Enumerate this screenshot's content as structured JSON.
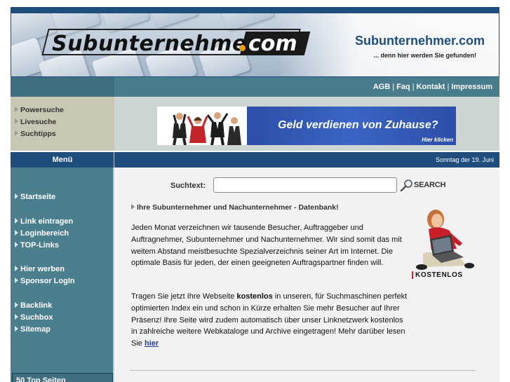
{
  "header": {
    "logo_text": "Subunternehmer",
    "logo_com": "com",
    "site_title": "Subunternehmer.com",
    "site_tagline": "... denn hier werden Sie gefunden!"
  },
  "top_links": [
    {
      "label": "AGB"
    },
    {
      "label": "Faq"
    },
    {
      "label": "Kontakt"
    },
    {
      "label": "Impressum"
    }
  ],
  "quick_links": [
    {
      "label": "Powersuche"
    },
    {
      "label": "Livesuche"
    },
    {
      "label": "Suchtipps"
    }
  ],
  "ad": {
    "headline": "Geld verdienen von Zuhause?",
    "click_label": "Hier klicken"
  },
  "menubar": {
    "title": "Menü",
    "date": "Sonntag der 19. Juni"
  },
  "sidebar": {
    "items": [
      {
        "label": "Startseite"
      },
      {
        "label": "Link eintragen"
      },
      {
        "label": "Loginbereich"
      },
      {
        "label": "TOP-Links"
      },
      {
        "label": "Hier werben"
      },
      {
        "label": "Sponsor LogIn"
      },
      {
        "label": "Backlink"
      },
      {
        "label": "Suchbox"
      },
      {
        "label": "Sitemap"
      }
    ],
    "box_label": "50 Top Seiten"
  },
  "search": {
    "label": "Suchtext:",
    "value": "",
    "placeholder": "",
    "button_label": "SEARCH"
  },
  "content": {
    "section_title": "Ihre Subunternehmer und Nachunternehmer - Datenbank!",
    "para1": "Jeden Monat verzeichnen wir tausende Besucher, Auftraggeber und Auftragnehmer, Subunternehmer und Nachunternehmer. Wir sind somit das mit weitem Abstand meistbesuchte Spezialverzeichnis seiner Art im Internet. Die optimale Basis für jeden, der einen geeigneten Auftragspartner finden will.",
    "para2_before": "Tragen Sie jetzt Ihre Webseite ",
    "para2_bold": "kostenlos",
    "para2_after": " in unseren, für Suchmaschinen perfekt optimierten Index ein und schon in Kürze erhalten Sie mehr Besucher auf Ihrer Präsenz! Ihre Seite wird zudem automatisch über unser Linknetzwerk kostenlos in zahlreiche weitere Webkataloge und Archive eingetragen! Mehr darüber lesen Sie ",
    "para2_link": "hier",
    "promo_label": "KOSTENLOS"
  },
  "colors": {
    "dark_blue": "#1f4e7e",
    "teal": "#487b8b",
    "sidebar_teal": "#4b7f8e",
    "strip_gray": "#ccd4d4",
    "ad_blue": "#2c4fa8"
  }
}
